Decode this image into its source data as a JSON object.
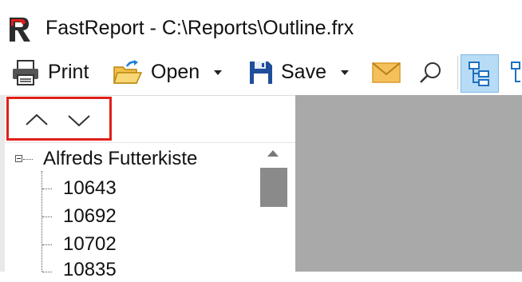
{
  "window": {
    "title": "FastReport - C:\\Reports\\Outline.frx",
    "logo_icon": "fastreport-logo-icon"
  },
  "toolbar": {
    "print_label": "Print",
    "open_label": "Open",
    "save_label": "Save",
    "icons": [
      "printer-icon",
      "open-folder-icon",
      "dropdown-arrow-icon",
      "floppy-disk-icon",
      "dropdown-arrow-icon",
      "envelope-icon",
      "search-icon",
      "outline-tree-icon"
    ]
  },
  "navigation": {
    "up_icon": "chevron-up-icon",
    "down_icon": "chevron-down-icon",
    "highlight_color": "#e0201a"
  },
  "tree": {
    "root_label": "Alfreds Futterkiste",
    "items": [
      "10643",
      "10692",
      "10702",
      "10835"
    ]
  },
  "colors": {
    "accent": "#1e7fd6",
    "preview_background": "#a9a9a9",
    "scroll_thumb": "#8a8a8a"
  }
}
